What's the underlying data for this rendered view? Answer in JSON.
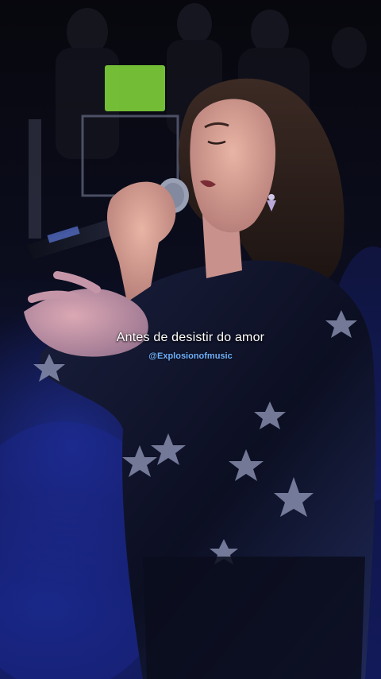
{
  "lyrics": {
    "line": "Antes de desistir do amor"
  },
  "watermark": {
    "handle": "@Explosionofmusic"
  },
  "colors": {
    "stage_light": "#1c2a9e",
    "background": "#05060f",
    "caption_text": "#ffffff",
    "watermark_text": "#6fb2ff"
  }
}
